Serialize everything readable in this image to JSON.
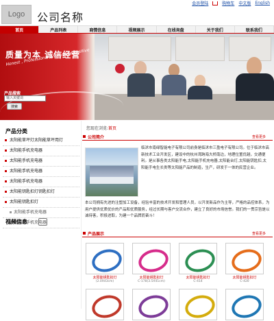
{
  "header": {
    "logo_text": "Logo",
    "company_name": "公司名称",
    "links": [
      "会员登陆",
      "购物车",
      "中文版",
      "English"
    ]
  },
  "nav": {
    "items": [
      "首页",
      "产品列表",
      "商情信息",
      "视频展示",
      "在线询盘",
      "关于我们",
      "联系我们"
    ],
    "active_index": 0
  },
  "banner": {
    "tagline": "质量为本 诚信经营",
    "subline": "Honest , Professional ,Innovative,Positive"
  },
  "search": {
    "label": "产品搜索",
    "placeholder": "输入关键词",
    "button": "搜索"
  },
  "breadcrumb": {
    "prefix": "您现在浏览:",
    "current": "首页"
  },
  "sidebar": {
    "title": "产品分类",
    "items": [
      {
        "label": "太阳能草坪灯太阳能草坪用灯",
        "sub": false
      },
      {
        "label": "太阳能手机充电器",
        "sub": false
      },
      {
        "label": "太阳能手机充电器",
        "sub": false
      },
      {
        "label": "太阳能手机充电器",
        "sub": false
      },
      {
        "label": "太阳能手机充电器",
        "sub": false
      },
      {
        "label": "太阳能钥匙扣灯钥匙扣灯",
        "sub": false
      },
      {
        "label": "太阳能钥匙扣灯",
        "sub": false
      },
      {
        "label": "太阳能手机充电器",
        "sub": true
      },
      {
        "label": "太阳能手机充电器",
        "sub": true
      }
    ],
    "video_title": "视频信息"
  },
  "intro": {
    "title": "公司简介",
    "more": "查看更多",
    "para1": "临沭市南绿智能电子有限公司前身是临沭市三盈电子有限公司。位于临沭市高新技术工业开发区，建设中的杭州湾跨海大桥南边，地理位置优越，交通便利。是从事各类太阳能手电,太阳能手机充电器,太阳能台灯,太阳能钥匙扣,太阳能手电生长类等太阳能产品的制造，生产，研发于一体的民营企业。",
    "para2": "本公司拥有先进的注塑加工设备，经验丰富的技术开发和管理人员，以开发新品作为主导，严格的品控体系，为用户提供优质优价的产品和优质服务，经过长期与客户交流合作，建立了良好的市场信誉。我们的一贯宗旨是以诚待客，积极进取，为建一个品牌而奋斗！"
  },
  "products": {
    "title": "产品展示",
    "more": "查看更多",
    "items": [
      {
        "name": "太阳能钥匙扣灯",
        "spec": "(2.0X43cm)",
        "color": "#2e6fc2"
      },
      {
        "name": "太阳能钥匙扣灯",
        "spec": "C-178(3.5X41cm)",
        "color": "#d62c8b"
      },
      {
        "name": "太阳能钥匙扣灯",
        "spec": "C-414",
        "color": "#2c8f53"
      },
      {
        "name": "太阳能钥匙扣灯",
        "spec": "C-420",
        "color": "#e56d1b"
      },
      {
        "name": "",
        "spec": "",
        "color": "#c0392b"
      },
      {
        "name": "",
        "spec": "",
        "color": "#7d3c98"
      },
      {
        "name": "",
        "spec": "",
        "color": "#d4ac0d"
      },
      {
        "name": "",
        "spec": "",
        "color": "#1f77b4"
      }
    ]
  }
}
